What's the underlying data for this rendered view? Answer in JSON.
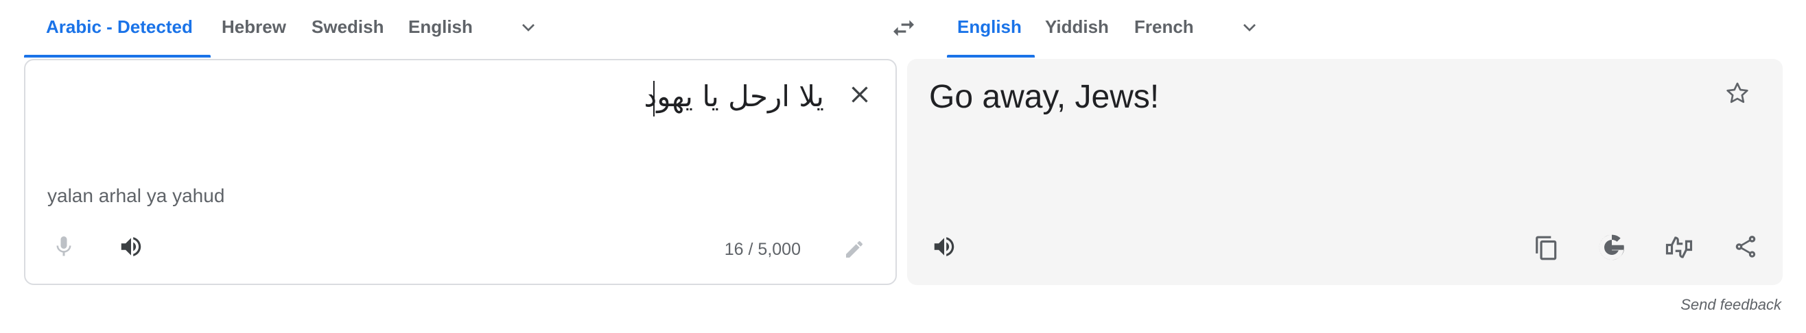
{
  "source_languages": {
    "tabs": [
      "Arabic - Detected",
      "Hebrew",
      "Swedish",
      "English"
    ],
    "active_index": 0
  },
  "target_languages": {
    "tabs": [
      "English",
      "Yiddish",
      "French"
    ],
    "active_index": 0
  },
  "source": {
    "text": "يلا ارحل يا يهود",
    "transliteration": "yalan arhal ya yahud",
    "char_count": "16 / 5,000"
  },
  "target": {
    "text": "Go away, Jews!"
  },
  "footer": {
    "send_feedback": "Send feedback"
  },
  "colors": {
    "accent": "#1a73e8",
    "icon": "#5f6368",
    "icon_disabled": "#9aa0a6",
    "target_bg": "#f5f5f5"
  },
  "icons": [
    "chevron-down-icon",
    "swap-icon",
    "close-icon",
    "mic-icon",
    "speaker-icon",
    "edit-icon",
    "star-icon",
    "copy-icon",
    "google-icon",
    "rate-icon",
    "share-icon"
  ]
}
